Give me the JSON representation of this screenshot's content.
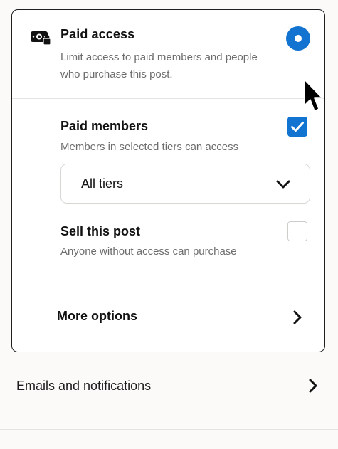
{
  "paid_access": {
    "icon": "money-lock-icon",
    "title": "Paid access",
    "description": "Limit access to paid members and people who purchase this post.",
    "selected": true
  },
  "paid_members": {
    "title": "Paid members",
    "description": "Members in selected tiers can access",
    "checked": true
  },
  "tiers_dropdown": {
    "value": "All tiers",
    "icon": "chevron-down-icon"
  },
  "sell_post": {
    "title": "Sell this post",
    "description": "Anyone without access can purchase",
    "checked": false
  },
  "more_options": {
    "label": "More options",
    "icon": "chevron-right-icon"
  },
  "emails_notifications": {
    "label": "Emails and notifications",
    "icon": "chevron-right-icon"
  },
  "colors": {
    "accent": "#1273d0",
    "text": "#121212",
    "muted": "#6d6d6d",
    "border": "#1f1f1f"
  }
}
